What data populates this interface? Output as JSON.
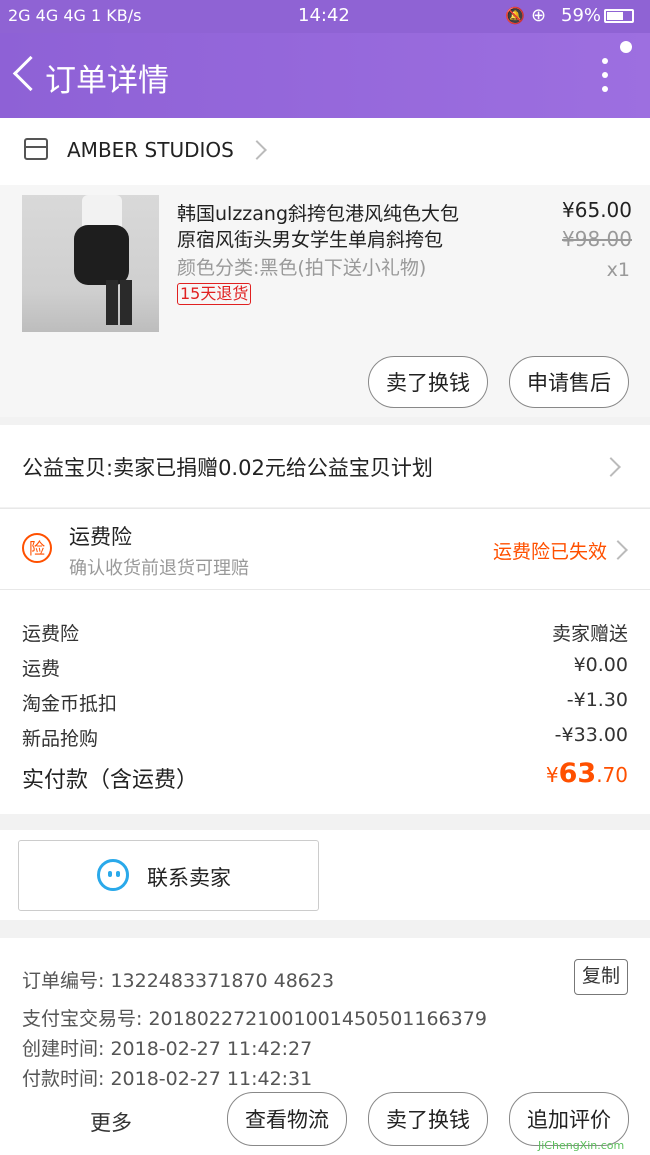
{
  "status": {
    "left": "2G 4G 4G 1 KB/s",
    "time": "14:42",
    "battery": "59%"
  },
  "header": {
    "title": "订单详情"
  },
  "shop": {
    "name": "AMBER STUDIOS"
  },
  "item": {
    "title_line1": "韩国ulzzang斜挎包港风纯色大包",
    "title_line2": "原宿风街头男女学生单肩斜挎包",
    "variant": "颜色分类:黑色(拍下送小礼物)",
    "tag": "15天退货",
    "price": "¥65.00",
    "original_price": "¥98.00",
    "qty": "x1",
    "buttons": {
      "sell": "卖了换钱",
      "after_sale": "申请售后"
    }
  },
  "charity": {
    "text": "公益宝贝:卖家已捐赠0.02元给公益宝贝计划"
  },
  "insurance": {
    "badge": "险",
    "title": "运费险",
    "subtitle": "确认收货前退货可理赔",
    "status": "运费险已失效",
    "status_color": "#ff5000"
  },
  "costs": {
    "rows": [
      {
        "label": "运费险",
        "value": "卖家赠送"
      },
      {
        "label": "运费",
        "value": "¥0.00"
      },
      {
        "label": "淘金币抵扣",
        "value": "-¥1.30"
      },
      {
        "label": "新品抢购",
        "value": "-¥33.00"
      }
    ],
    "total_label": "实付款（含运费）",
    "total_symbol": "¥",
    "total_int": "63",
    "total_dec": ".70"
  },
  "contact": {
    "label": "联系卖家"
  },
  "order": {
    "number": "订单编号: 1322483371870 48623",
    "alipay": "支付宝交易号: 2018022721001001450501166379",
    "created": "创建时间: 2018-02-27 11:42:27",
    "paid": "付款时间: 2018-02-27 11:42:31",
    "copy": "复制"
  },
  "footer": {
    "more": "更多",
    "logistics": "查看物流",
    "sell": "卖了换钱",
    "review": "追加评价"
  },
  "watermark": {
    "text": "JiChengXin.com"
  },
  "colors": {
    "accent": "#ff5000",
    "header": "#9068d8"
  }
}
